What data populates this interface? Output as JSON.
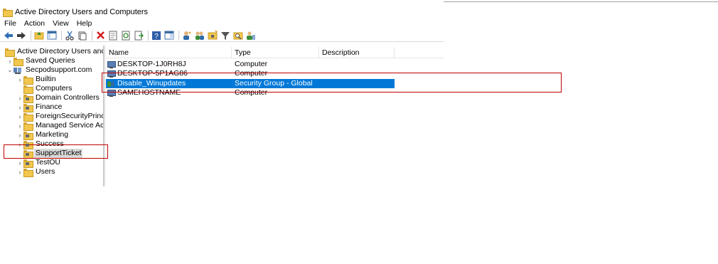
{
  "window": {
    "title": "Active Directory Users and Computers"
  },
  "menu": [
    "File",
    "Action",
    "View",
    "Help"
  ],
  "toolbar": {
    "icons": [
      "back-arrow-icon",
      "forward-arrow-icon",
      "up-folder-icon",
      "console-tree-icon",
      "cut-icon",
      "copy-icon",
      "delete-icon",
      "properties-icon",
      "refresh-icon",
      "export-icon",
      "help-icon",
      "details-pane-icon",
      "new-user-icon",
      "new-group-icon",
      "new-ou-icon",
      "filter-icon",
      "find-icon",
      "add-to-group-icon"
    ]
  },
  "tree": {
    "root": "Active Directory Users and Com",
    "saved_queries": "Saved Queries",
    "domain": "Secpodsupport.com",
    "children": [
      {
        "label": "Builtin",
        "expandable": true
      },
      {
        "label": "Computers",
        "expandable": false
      },
      {
        "label": "Domain Controllers",
        "expandable": true
      },
      {
        "label": "Finance",
        "expandable": true
      },
      {
        "label": "ForeignSecurityPrincipals",
        "expandable": true
      },
      {
        "label": "Managed Service Accour",
        "expandable": true
      },
      {
        "label": "Marketing",
        "expandable": true
      },
      {
        "label": "Success",
        "expandable": true
      },
      {
        "label": "SupportTicket",
        "expandable": false
      },
      {
        "label": "TestOU",
        "expandable": true
      },
      {
        "label": "Users",
        "expandable": true
      }
    ]
  },
  "list": {
    "columns": [
      "Name",
      "Type",
      "Description"
    ],
    "rows": [
      {
        "name": "DESKTOP-1J0RH8J",
        "type": "Computer",
        "description": "",
        "icon": "computer-icon"
      },
      {
        "name": "DESKTOP-5P1AG86",
        "type": "Computer",
        "description": "",
        "icon": "computer-icon"
      },
      {
        "name": "Disable_Winupdates",
        "type": "Security Group - Global",
        "description": "",
        "icon": "group-icon"
      },
      {
        "name": "SAMEHOSTNAME",
        "type": "Computer",
        "description": "",
        "icon": "computer-icon"
      }
    ]
  },
  "colors": {
    "selection": "#0078d7",
    "annotation": "#c00000"
  }
}
